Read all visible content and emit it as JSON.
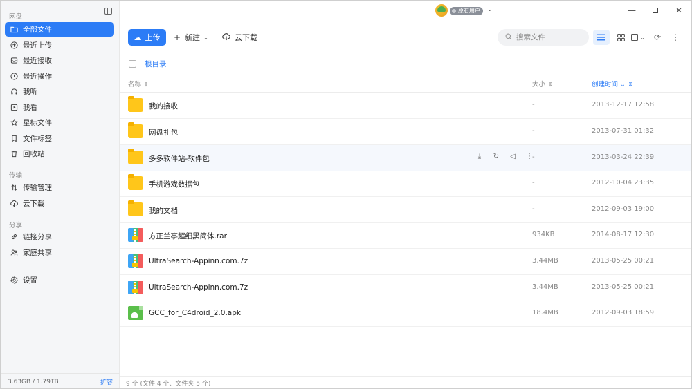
{
  "sidebar": {
    "groups": {
      "netdisk": "网盘",
      "transfer": "传输",
      "share": "分享"
    },
    "items": [
      {
        "label": "全部文件",
        "icon": "folder-icon"
      },
      {
        "label": "最近上传",
        "icon": "upload-circle-icon"
      },
      {
        "label": "最近接收",
        "icon": "inbox-icon"
      },
      {
        "label": "最近操作",
        "icon": "history-icon"
      },
      {
        "label": "我听",
        "icon": "headphones-icon"
      },
      {
        "label": "我看",
        "icon": "play-icon"
      },
      {
        "label": "星标文件",
        "icon": "star-icon"
      },
      {
        "label": "文件标签",
        "icon": "bookmark-icon"
      },
      {
        "label": "回收站",
        "icon": "trash-icon"
      },
      {
        "label": "传输管理",
        "icon": "transfer-icon"
      },
      {
        "label": "云下载",
        "icon": "cloud-download-icon"
      },
      {
        "label": "链接分享",
        "icon": "link-icon"
      },
      {
        "label": "家庭共享",
        "icon": "family-icon"
      },
      {
        "label": "设置",
        "icon": "gear-icon"
      }
    ],
    "storage": "3.63GB / 1.79TB",
    "expand_label": "扩容"
  },
  "titlebar": {
    "user_badge": "原石用户"
  },
  "toolbar": {
    "upload_label": "上传",
    "new_label": "新建",
    "cloud_download_label": "云下载",
    "search_placeholder": "搜索文件"
  },
  "breadcrumb": {
    "root": "根目录"
  },
  "table": {
    "columns": {
      "name": "名称",
      "size": "大小",
      "created": "创建时间"
    },
    "rows": [
      {
        "name": "我的接收",
        "size": "-",
        "date": "2013-12-17 12:58",
        "type": "folder"
      },
      {
        "name": "网盘礼包",
        "size": "-",
        "date": "2013-07-31 01:32",
        "type": "folder"
      },
      {
        "name": "多多软件站-软件包",
        "size": "-",
        "date": "2013-03-24 22:39",
        "type": "folder"
      },
      {
        "name": "手机游戏数据包",
        "size": "-",
        "date": "2012-10-04 23:35",
        "type": "folder"
      },
      {
        "name": "我的文档",
        "size": "-",
        "date": "2012-09-03 19:00",
        "type": "folder"
      },
      {
        "name": "方正兰亭超细黑简体.rar",
        "size": "934KB",
        "date": "2014-08-17 12:30",
        "type": "rar"
      },
      {
        "name": "UltraSearch-Appinn.com.7z",
        "size": "3.44MB",
        "date": "2013-05-25 00:21",
        "type": "rar"
      },
      {
        "name": "UltraSearch-Appinn.com.7z",
        "size": "3.44MB",
        "date": "2013-05-25 00:21",
        "type": "rar"
      },
      {
        "name": "GCC_for_C4droid_2.0.apk",
        "size": "18.4MB",
        "date": "2012-09-03 18:59",
        "type": "apk"
      }
    ]
  },
  "status": "9 个 (文件 4 个、文件夹 5 个)",
  "colors": {
    "accent": "#2c7cf6",
    "folder": "#ffc61a"
  }
}
